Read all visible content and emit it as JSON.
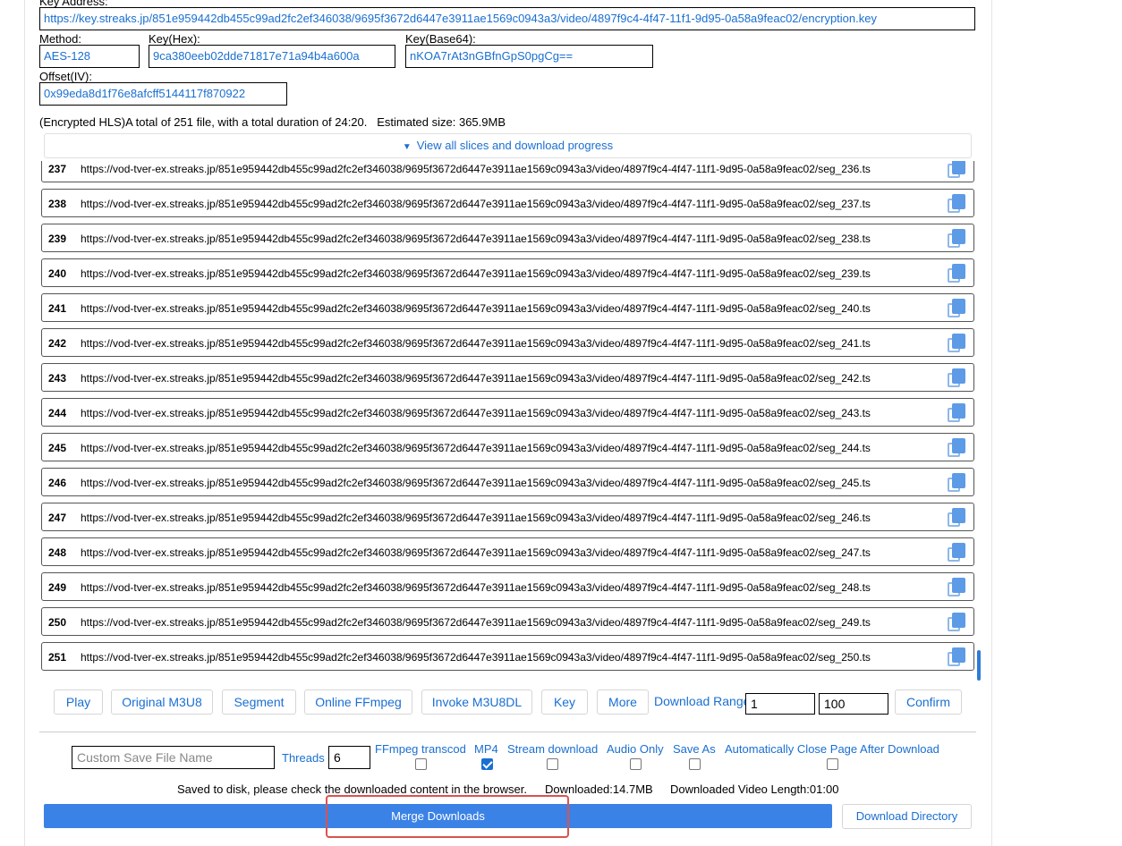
{
  "key_address": {
    "label": "Key Address:",
    "value": "https://key.streaks.jp/851e959442db455c99ad2fc2ef346038/9695f3672d6447e3911ae1569c0943a3/video/4897f9c4-4f47-11f1-9d95-0a58a9feac02/encryption.key"
  },
  "method": {
    "label": "Method:",
    "value": "AES-128"
  },
  "key_hex": {
    "label": "Key(Hex):",
    "value": "9ca380eeb02dde71817e71a94b4a600a"
  },
  "key_b64": {
    "label": "Key(Base64):",
    "value": "nKOA7rAt3nGBfnGpS0pgCg=="
  },
  "offset": {
    "label": "Offset(IV):",
    "value": "0x99eda8d1f76e8afcff5144117f870922"
  },
  "summary": "(Encrypted HLS)A total of 251 file, with a total duration of 24:20.   Estimated size: 365.9MB",
  "slices_toggle": {
    "icon": "triangle-down-icon",
    "label": "View all slices and download progress"
  },
  "segments": [
    {
      "num": "237",
      "url": "https://vod-tver-ex.streaks.jp/851e959442db455c99ad2fc2ef346038/9695f3672d6447e3911ae1569c0943a3/video/4897f9c4-4f47-11f1-9d95-0a58a9feac02/seg_236.ts"
    },
    {
      "num": "238",
      "url": "https://vod-tver-ex.streaks.jp/851e959442db455c99ad2fc2ef346038/9695f3672d6447e3911ae1569c0943a3/video/4897f9c4-4f47-11f1-9d95-0a58a9feac02/seg_237.ts"
    },
    {
      "num": "239",
      "url": "https://vod-tver-ex.streaks.jp/851e959442db455c99ad2fc2ef346038/9695f3672d6447e3911ae1569c0943a3/video/4897f9c4-4f47-11f1-9d95-0a58a9feac02/seg_238.ts"
    },
    {
      "num": "240",
      "url": "https://vod-tver-ex.streaks.jp/851e959442db455c99ad2fc2ef346038/9695f3672d6447e3911ae1569c0943a3/video/4897f9c4-4f47-11f1-9d95-0a58a9feac02/seg_239.ts"
    },
    {
      "num": "241",
      "url": "https://vod-tver-ex.streaks.jp/851e959442db455c99ad2fc2ef346038/9695f3672d6447e3911ae1569c0943a3/video/4897f9c4-4f47-11f1-9d95-0a58a9feac02/seg_240.ts"
    },
    {
      "num": "242",
      "url": "https://vod-tver-ex.streaks.jp/851e959442db455c99ad2fc2ef346038/9695f3672d6447e3911ae1569c0943a3/video/4897f9c4-4f47-11f1-9d95-0a58a9feac02/seg_241.ts"
    },
    {
      "num": "243",
      "url": "https://vod-tver-ex.streaks.jp/851e959442db455c99ad2fc2ef346038/9695f3672d6447e3911ae1569c0943a3/video/4897f9c4-4f47-11f1-9d95-0a58a9feac02/seg_242.ts"
    },
    {
      "num": "244",
      "url": "https://vod-tver-ex.streaks.jp/851e959442db455c99ad2fc2ef346038/9695f3672d6447e3911ae1569c0943a3/video/4897f9c4-4f47-11f1-9d95-0a58a9feac02/seg_243.ts"
    },
    {
      "num": "245",
      "url": "https://vod-tver-ex.streaks.jp/851e959442db455c99ad2fc2ef346038/9695f3672d6447e3911ae1569c0943a3/video/4897f9c4-4f47-11f1-9d95-0a58a9feac02/seg_244.ts"
    },
    {
      "num": "246",
      "url": "https://vod-tver-ex.streaks.jp/851e959442db455c99ad2fc2ef346038/9695f3672d6447e3911ae1569c0943a3/video/4897f9c4-4f47-11f1-9d95-0a58a9feac02/seg_245.ts"
    },
    {
      "num": "247",
      "url": "https://vod-tver-ex.streaks.jp/851e959442db455c99ad2fc2ef346038/9695f3672d6447e3911ae1569c0943a3/video/4897f9c4-4f47-11f1-9d95-0a58a9feac02/seg_246.ts"
    },
    {
      "num": "248",
      "url": "https://vod-tver-ex.streaks.jp/851e959442db455c99ad2fc2ef346038/9695f3672d6447e3911ae1569c0943a3/video/4897f9c4-4f47-11f1-9d95-0a58a9feac02/seg_247.ts"
    },
    {
      "num": "249",
      "url": "https://vod-tver-ex.streaks.jp/851e959442db455c99ad2fc2ef346038/9695f3672d6447e3911ae1569c0943a3/video/4897f9c4-4f47-11f1-9d95-0a58a9feac02/seg_248.ts"
    },
    {
      "num": "250",
      "url": "https://vod-tver-ex.streaks.jp/851e959442db455c99ad2fc2ef346038/9695f3672d6447e3911ae1569c0943a3/video/4897f9c4-4f47-11f1-9d95-0a58a9feac02/seg_249.ts"
    },
    {
      "num": "251",
      "url": "https://vod-tver-ex.streaks.jp/851e959442db455c99ad2fc2ef346038/9695f3672d6447e3911ae1569c0943a3/video/4897f9c4-4f47-11f1-9d95-0a58a9feac02/seg_250.ts"
    }
  ],
  "segment_icon": "copy-icon",
  "toolbar": {
    "play": "Play",
    "original_m3u8": "Original M3U8",
    "segment": "Segment",
    "online_ffmpeg": "Online FFmpeg",
    "invoke_m3u8dl": "Invoke M3U8DL",
    "key": "Key",
    "more": "More",
    "download_range_label": "Download Range",
    "range_start": "1",
    "range_end": "100",
    "confirm": "Confirm"
  },
  "options": {
    "save_name_placeholder": "Custom Save File Name",
    "threads_label": "Threads",
    "threads_value": "6",
    "ffmpeg_transcode": {
      "label": "FFmpeg transcod",
      "checked": false
    },
    "mp4": {
      "label": "MP4",
      "checked": true
    },
    "stream_download": {
      "label": "Stream download",
      "checked": false
    },
    "audio_only": {
      "label": "Audio Only",
      "checked": false
    },
    "save_as": {
      "label": "Save As",
      "checked": false
    },
    "auto_close": {
      "label": "Automatically Close Page After Download",
      "checked": false
    }
  },
  "status": {
    "saved": "Saved to disk, please check the downloaded content in the browser.",
    "downloaded": "Downloaded:14.7MB",
    "video_length": "Downloaded Video Length:01:00"
  },
  "merge_button": "Merge Downloads",
  "download_dir_button": "Download Directory",
  "colors": {
    "accent": "#1a6fd1",
    "merge_bg": "#3b82e6",
    "highlight": "#d9534f"
  }
}
